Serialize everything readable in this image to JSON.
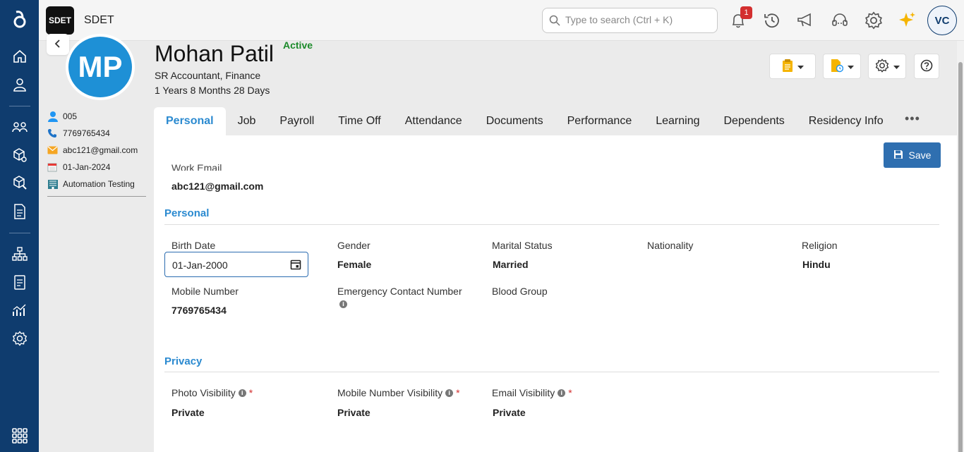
{
  "app": {
    "name": "SDET",
    "logo_text": "SDET"
  },
  "search": {
    "placeholder": "Type to search (Ctrl + K)"
  },
  "topbar": {
    "notification_count": "1",
    "icons": [
      "bell-icon",
      "history-icon",
      "megaphone-icon",
      "headset-icon",
      "gear-icon",
      "sparkle-icon"
    ],
    "user_initials": "VC"
  },
  "rail": {
    "icons": [
      "app-logo-icon",
      "home-icon",
      "employee-icon",
      "team-icon",
      "box-settings-icon",
      "box-tools-icon",
      "document-icon",
      "org-chart-icon",
      "report-icon",
      "analytics-icon",
      "settings-icon",
      "apps-grid-icon"
    ]
  },
  "employee": {
    "initials": "MP",
    "name": "Mohan Patil",
    "status": "Active",
    "title": "SR Accountant, Finance",
    "tenure": "1 Years 8 Months 28 Days",
    "id": "005",
    "phone": "7769765434",
    "email": "abc121@gmail.com",
    "join_date": "01-Jan-2024",
    "department": "Automation Testing"
  },
  "tabs": [
    {
      "label": "Personal",
      "active": true
    },
    {
      "label": "Job"
    },
    {
      "label": "Payroll"
    },
    {
      "label": "Time Off"
    },
    {
      "label": "Attendance"
    },
    {
      "label": "Documents"
    },
    {
      "label": "Performance"
    },
    {
      "label": "Learning"
    },
    {
      "label": "Dependents"
    },
    {
      "label": "Residency Info"
    }
  ],
  "tab_more": "•••",
  "form": {
    "save_label": "Save",
    "work_email_label": "Work Email",
    "work_email_value": "abc121@gmail.com",
    "personal_section": "Personal",
    "birth_date_label": "Birth Date",
    "birth_date_value": "01-Jan-2000",
    "gender_label": "Gender",
    "gender_value": "Female",
    "marital_label": "Marital Status",
    "marital_value": "Married",
    "nationality_label": "Nationality",
    "religion_label": "Religion",
    "religion_value": "Hindu",
    "mobile_label": "Mobile Number",
    "mobile_value": "7769765434",
    "emergency_label": "Emergency Contact Number",
    "blood_label": "Blood Group",
    "privacy_section": "Privacy",
    "photo_vis_label": "Photo Visibility",
    "photo_vis_value": "Private",
    "mobile_vis_label": "Mobile Number Visibility",
    "mobile_vis_value": "Private",
    "email_vis_label": "Email Visibility",
    "email_vis_value": "Private",
    "required_mark": "*"
  },
  "colors": {
    "rail": "#0f3c6e",
    "accent": "#2b8ad0",
    "active_status": "#1b8a2a",
    "save": "#2f6fb0",
    "avatar": "#1e90d6"
  }
}
